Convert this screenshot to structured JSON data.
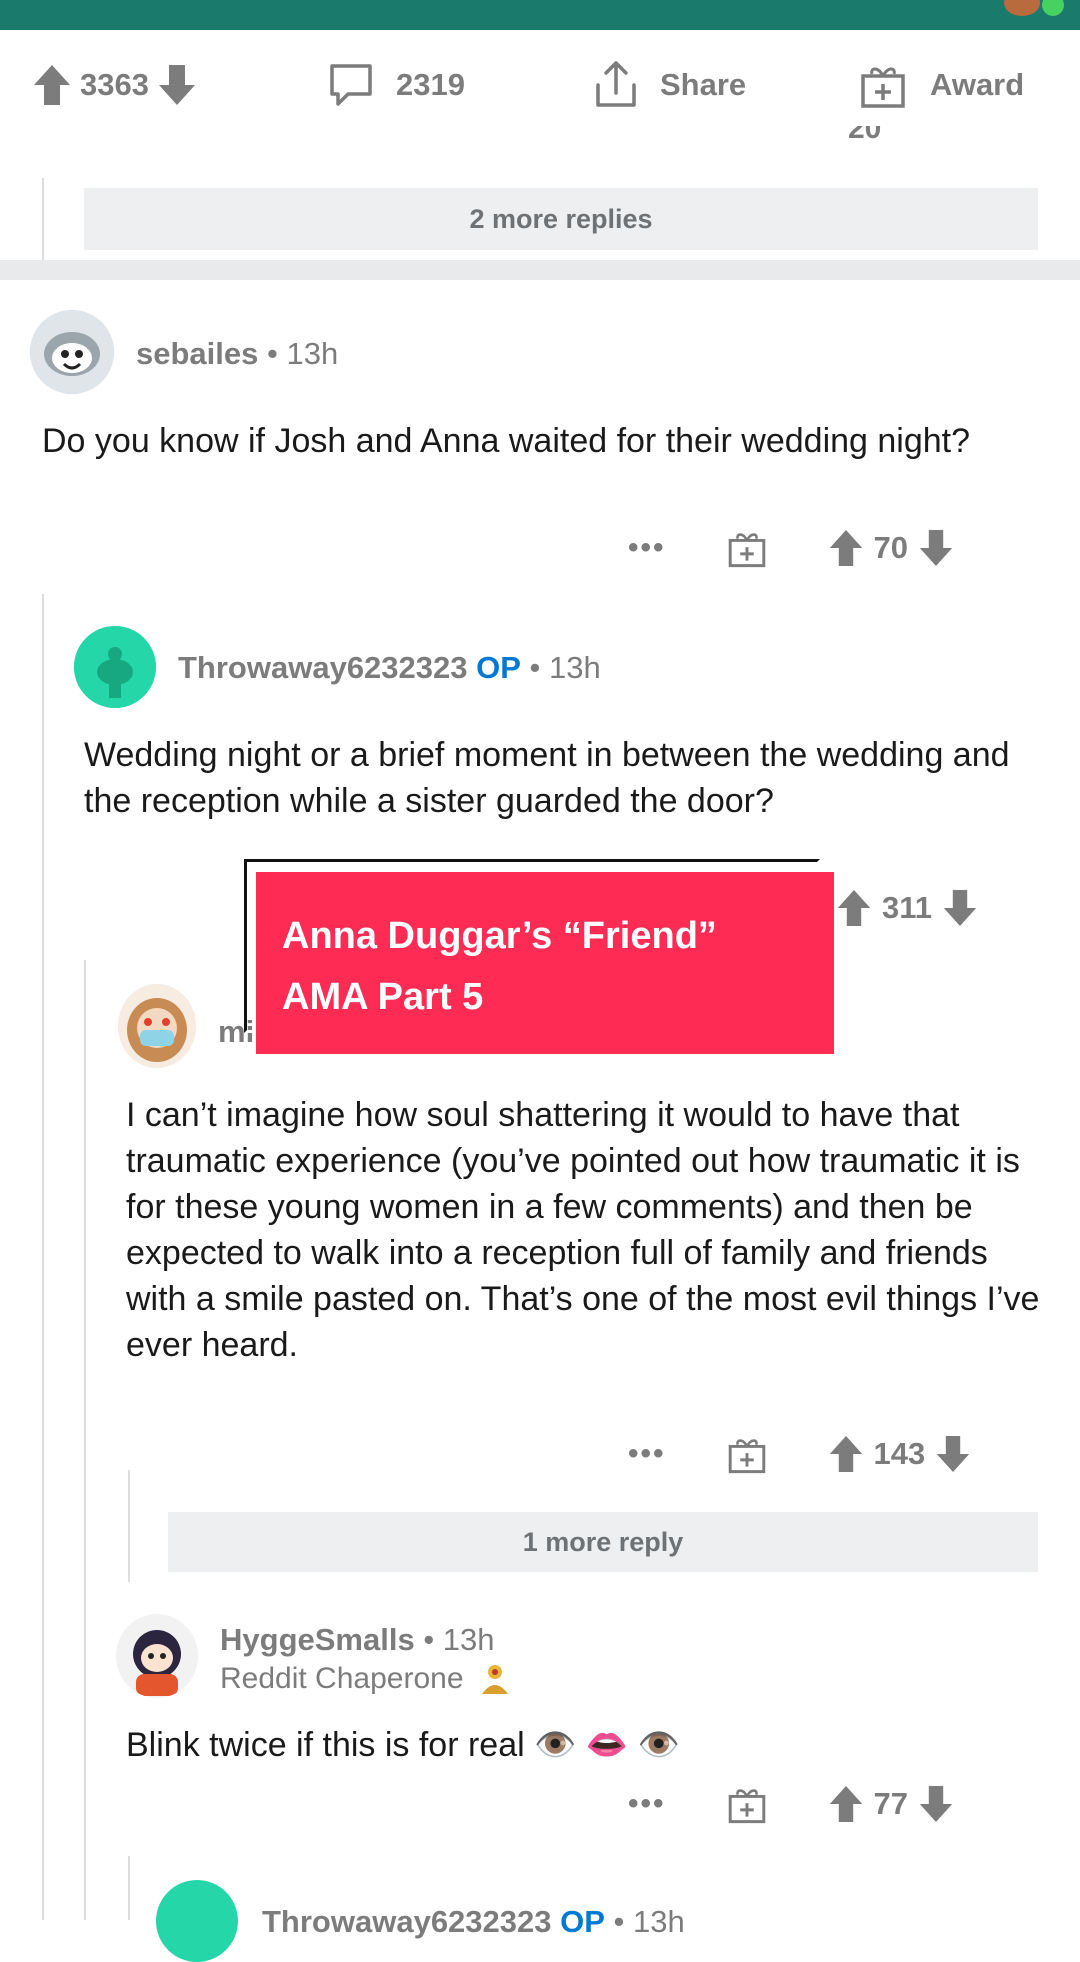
{
  "action_bar": {
    "upvotes": "3363",
    "comments": "2319",
    "share_label": "Share",
    "award_label": "Award"
  },
  "partial_row_text": "20",
  "more_replies_1": "2 more replies",
  "comments": [
    {
      "username": "sebailes",
      "time": "13h",
      "body": "Do you know if Josh and Anna waited for their wedding night?",
      "votes": "70"
    },
    {
      "username": "Throwaway6232323",
      "op_badge": "OP",
      "time": "13h",
      "body": "Wedding night or a brief moment in between the wedding and the reception while a sister guarded the door?",
      "votes": "311"
    },
    {
      "username": "mi",
      "body": "I can’t imagine how soul shattering it would to have that traumatic experience (you’ve pointed out how traumatic it is for these young women in a few comments) and then be expected to walk into a reception full of family and friends with a smile pasted on. That’s one of the most evil things I’ve ever heard.",
      "votes": "143"
    },
    {
      "username": "HyggeSmalls",
      "time": "13h",
      "flair": "Reddit Chaperone",
      "body": "Blink twice if this is for real 👁️ 👄 👁️",
      "votes": "77"
    },
    {
      "username": "Throwaway6232323",
      "op_badge": "OP",
      "time": "13h"
    }
  ],
  "more_replies_2": "1 more reply",
  "overlay": {
    "line1": "Anna Duggar’s “Friend”",
    "line2": "AMA Part 5"
  },
  "colors": {
    "status_bar": "#1a7a6c",
    "banner": "#fe2c55",
    "op": "#0079d3",
    "muted": "#7c7c7c"
  },
  "icons": [
    "upvote-icon",
    "downvote-icon",
    "comment-icon",
    "share-icon",
    "award-icon",
    "more-icon"
  ]
}
